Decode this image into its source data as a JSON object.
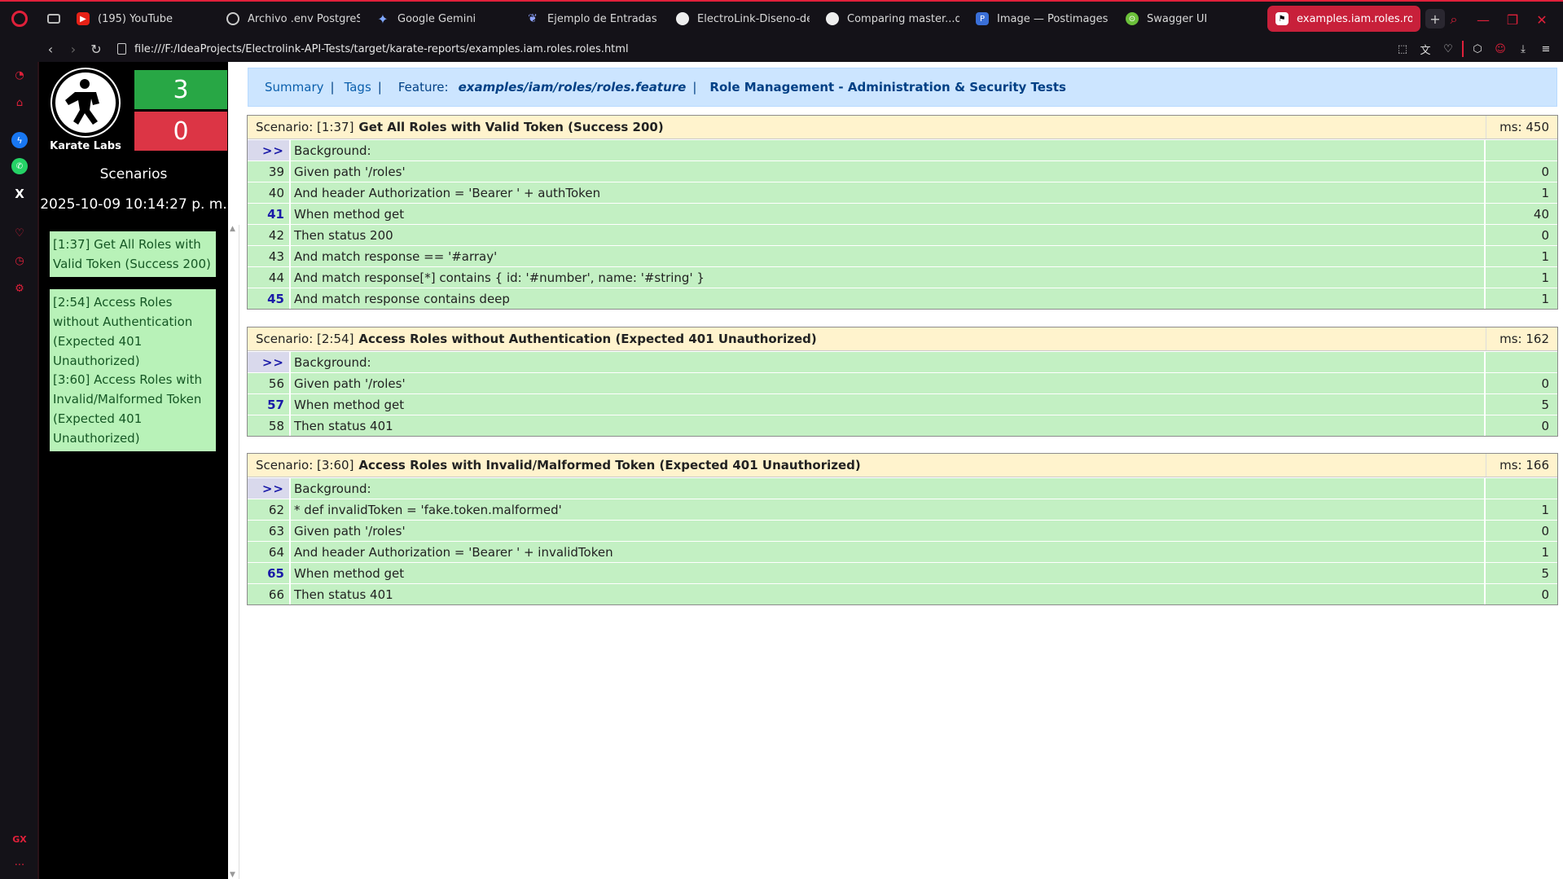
{
  "browser": {
    "tabs": [
      {
        "title": "(195) YouTube",
        "icon": "youtube-icon"
      },
      {
        "title": "Archivo .env PostgreSQL",
        "icon": "openai-icon"
      },
      {
        "title": "Google Gemini",
        "icon": "gemini-icon"
      },
      {
        "title": "Ejemplo de Entradas JSON",
        "icon": "jsonquery-icon"
      },
      {
        "title": "ElectroLink-Diseno-de-BD",
        "icon": "github-icon"
      },
      {
        "title": "Comparing master...dev",
        "icon": "github-icon"
      },
      {
        "title": "Image — Postimages",
        "icon": "postimages-icon"
      },
      {
        "title": "Swagger UI",
        "icon": "swagger-icon"
      },
      {
        "title": "examples.iam.roles.roles",
        "icon": "karate-icon",
        "active": true
      }
    ],
    "new_tab": "+",
    "url": "file:///F:/IdeaProjects/Electrolink-API-Tests/target/karate-reports/examples.iam.roles.roles.html",
    "accent": "#e0203a"
  },
  "nav": {
    "logo_text": "Karate Labs",
    "passed": "3",
    "failed": "0",
    "heading": "Scenarios",
    "date": "2025-10-09 10:14:27 p. m.",
    "links": [
      "[1:37] Get All Roles with Valid Token (Success 200)",
      "[2:54] Access Roles without Authentication (Expected 401 Unauthorized)",
      "[3:60] Access Roles with Invalid/Malformed Token (Expected 401 Unauthorized)"
    ]
  },
  "header": {
    "summary": "Summary",
    "tags": "Tags",
    "sep": "|",
    "feature_label": "Feature:",
    "feature_path": "examples/iam/roles/roles.feature",
    "feature_desc": "Role Management - Administration & Security Tests"
  },
  "scenarios": [
    {
      "prefix": "Scenario: [1:37]",
      "name": "Get All Roles with Valid Token (Success 200)",
      "ms": "ms: 450",
      "steps": [
        {
          "ln": ">>",
          "text": "Background:",
          "ms": "",
          "kind": "bg"
        },
        {
          "ln": "39",
          "text": "Given path '/roles'",
          "ms": "0"
        },
        {
          "ln": "40",
          "text": "And header Authorization = 'Bearer ' + authToken",
          "ms": "1"
        },
        {
          "ln": "41",
          "text": "When method get",
          "ms": "40",
          "kind": "bold"
        },
        {
          "ln": "42",
          "text": "Then status 200",
          "ms": "0"
        },
        {
          "ln": "43",
          "text": "And match response == '#array'",
          "ms": "1"
        },
        {
          "ln": "44",
          "text": "And match response[*] contains { id: '#number', name: '#string' }",
          "ms": "1"
        },
        {
          "ln": "45",
          "text": "And match response contains deep",
          "ms": "1",
          "kind": "bold"
        }
      ]
    },
    {
      "prefix": "Scenario: [2:54]",
      "name": "Access Roles without Authentication (Expected 401 Unauthorized)",
      "ms": "ms: 162",
      "steps": [
        {
          "ln": ">>",
          "text": "Background:",
          "ms": "",
          "kind": "bg"
        },
        {
          "ln": "56",
          "text": "Given path '/roles'",
          "ms": "0"
        },
        {
          "ln": "57",
          "text": "When method get",
          "ms": "5",
          "kind": "bold"
        },
        {
          "ln": "58",
          "text": "Then status 401",
          "ms": "0"
        }
      ]
    },
    {
      "prefix": "Scenario: [3:60]",
      "name": "Access Roles with Invalid/Malformed Token (Expected 401 Unauthorized)",
      "ms": "ms: 166",
      "steps": [
        {
          "ln": ">>",
          "text": "Background:",
          "ms": "",
          "kind": "bg"
        },
        {
          "ln": "62",
          "text": "* def invalidToken = 'fake.token.malformed'",
          "ms": "1"
        },
        {
          "ln": "63",
          "text": "Given path '/roles'",
          "ms": "0"
        },
        {
          "ln": "64",
          "text": "And header Authorization = 'Bearer ' + invalidToken",
          "ms": "1"
        },
        {
          "ln": "65",
          "text": "When method get",
          "ms": "5",
          "kind": "bold"
        },
        {
          "ln": "66",
          "text": "Then status 401",
          "ms": "0"
        }
      ]
    }
  ]
}
